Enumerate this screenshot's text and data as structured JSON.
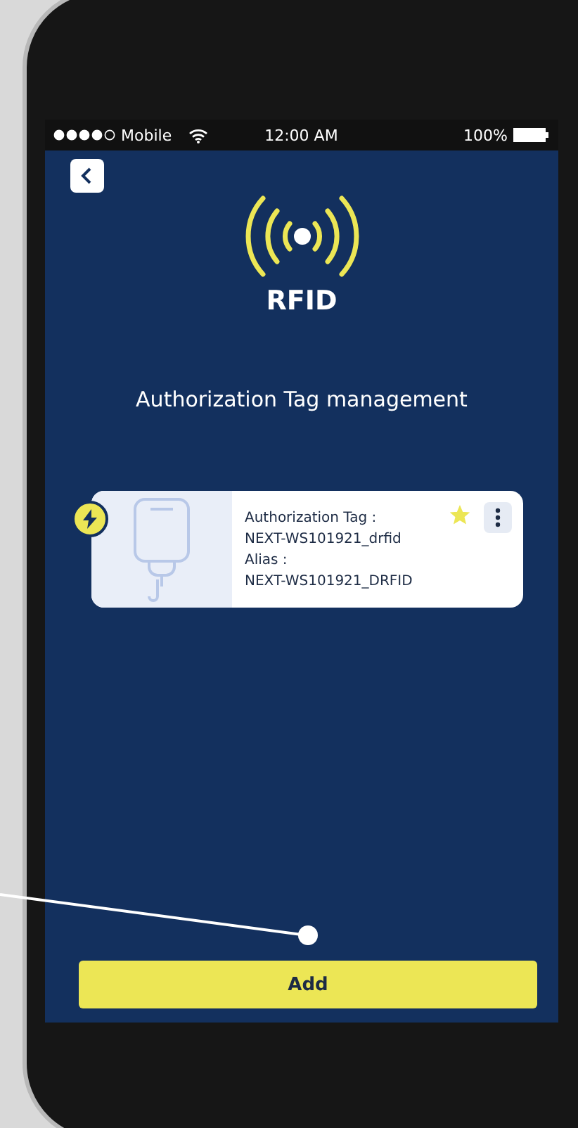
{
  "status_bar": {
    "carrier": "Mobile",
    "time": "12:00 AM",
    "battery": "100%"
  },
  "header": {
    "title": "RFID",
    "subtitle": "Authorization Tag management"
  },
  "tags": [
    {
      "tag_label": "Authorization Tag :",
      "tag_value": "NEXT-WS101921_drfid",
      "alias_label": "Alias :",
      "alias_value": "NEXT-WS101921_DRFID",
      "favorite": true
    }
  ],
  "buttons": {
    "add": "Add"
  }
}
